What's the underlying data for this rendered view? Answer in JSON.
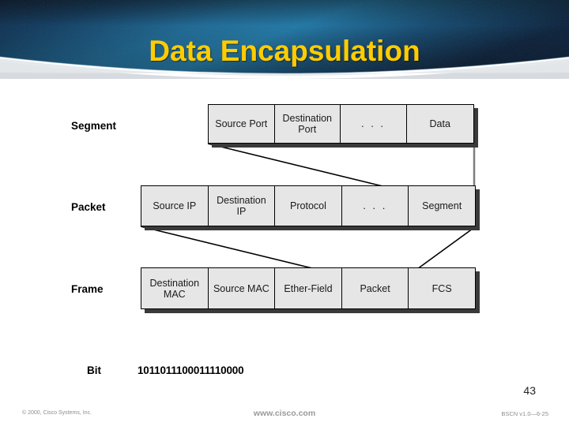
{
  "slide": {
    "title": "Data Encapsulation",
    "title_color": "#FFCC00",
    "banner_color_dark": "#0b2a4a",
    "banner_color_light": "#1d6f9e",
    "number": "43"
  },
  "diagram": {
    "rows": [
      {
        "label": "Segment",
        "cells": [
          "Source Port",
          "Destination Port",
          ". . .",
          "Data"
        ]
      },
      {
        "label": "Packet",
        "cells": [
          "Source IP",
          "Destination IP",
          "Protocol",
          ". . .",
          "Segment"
        ]
      },
      {
        "label": "Frame",
        "cells": [
          "Destination MAC",
          "Source MAC",
          "Ether-Field",
          "Packet",
          "FCS"
        ]
      }
    ],
    "bit_row": {
      "label": "Bit",
      "value": "1011011100011110000"
    }
  },
  "footer": {
    "copyright": "© 2000, Cisco Systems, Inc.",
    "url": "www.cisco.com",
    "course_code": "BSCN v1.0—6-25"
  }
}
